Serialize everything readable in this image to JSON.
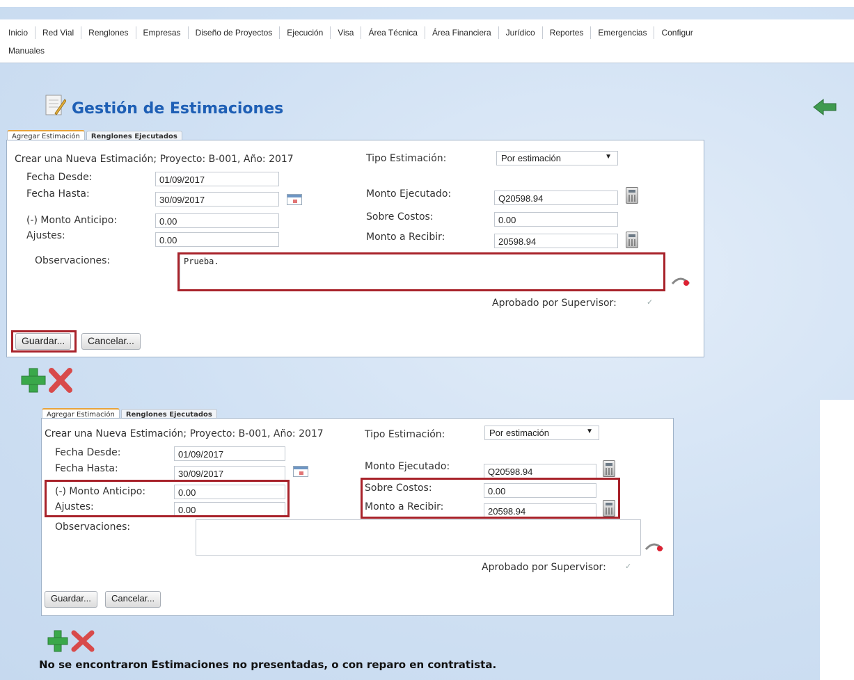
{
  "menu": {
    "items": [
      "Inicio",
      "Red Vial",
      "Renglones",
      "Empresas",
      "Diseño de Proyectos",
      "Ejecución",
      "Visa",
      "Área Técnica",
      "Área Financiera",
      "Jurídico",
      "Reportes",
      "Emergencias",
      "Configur"
    ],
    "row2": "Manuales"
  },
  "page_title": "Gestión de Estimaciones",
  "tabs": {
    "add": "Agregar Estimación",
    "rows": "Renglones Ejecutados"
  },
  "form": {
    "heading": "Crear una Nueva Estimación; Proyecto: B-001, Año: 2017",
    "fecha_desde_label": "Fecha Desde:",
    "fecha_desde": "01/09/2017",
    "fecha_hasta_label": "Fecha Hasta:",
    "fecha_hasta": "30/09/2017",
    "anticipo_label": "(-) Monto Anticipo:",
    "anticipo": "0.00",
    "ajustes_label": "Ajustes:",
    "ajustes": "0.00",
    "observ_label": "Observaciones:",
    "observ_value_top": "Prueba.",
    "observ_value_bottom": "",
    "tipo_label": "Tipo Estimación:",
    "tipo_value": "Por estimación",
    "ejecutado_label": "Monto Ejecutado:",
    "ejecutado": "Q20598.94",
    "sobre_label": "Sobre Costos:",
    "sobre": "0.00",
    "recibir_label": "Monto a Recibir:",
    "recibir": "20598.94",
    "aprobado_label": "Aprobado por Supervisor:",
    "save": "Guardar...",
    "cancel": "Cancelar..."
  },
  "footer_msg": "No se encontraron Estimaciones no presentadas, o con reparo en contratista.",
  "colors": {
    "title": "#1e5fb5",
    "highlight": "#a8222a",
    "add": "#3aa84a",
    "remove": "#d84a4a"
  }
}
